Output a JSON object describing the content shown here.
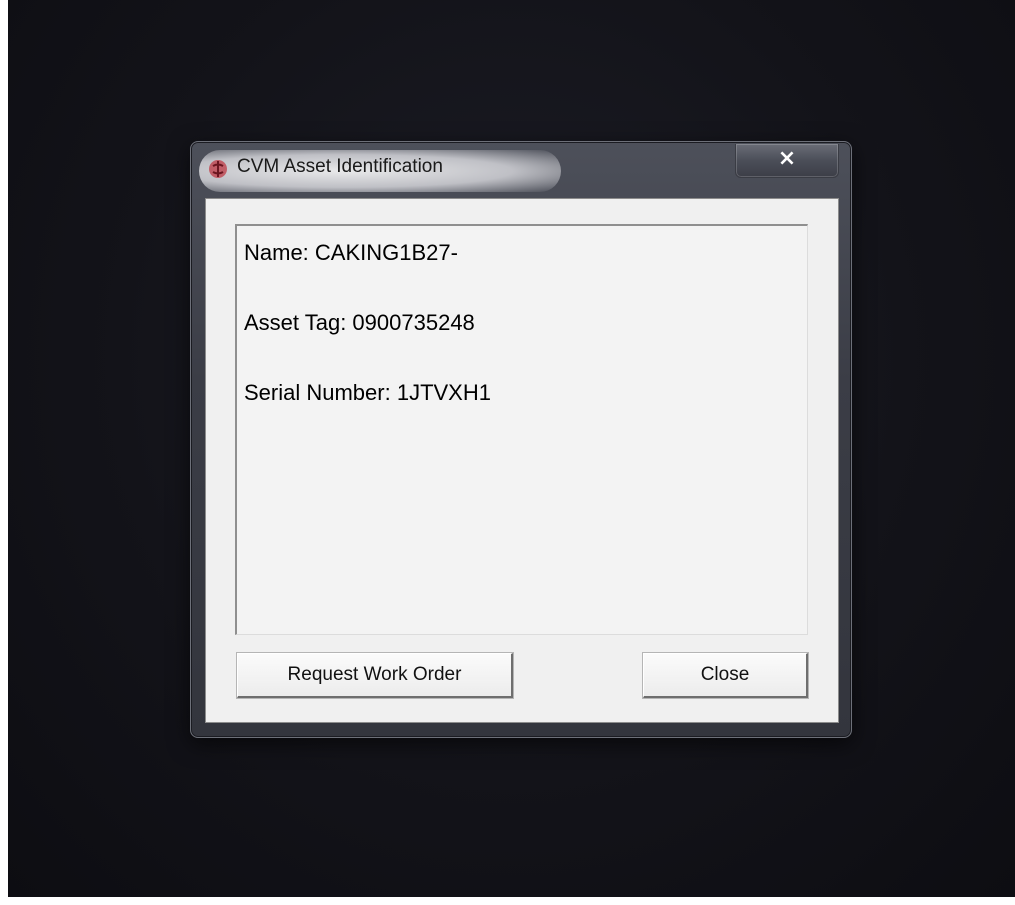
{
  "window": {
    "title": "CVM Asset Identification",
    "close_glyph": "×",
    "icon": "cvm-app-icon"
  },
  "info": {
    "name": "Name: CAKING1B27-",
    "asset_tag": "Asset Tag: 0900735248",
    "serial_number": "Serial Number: 1JTVXH1"
  },
  "buttons": {
    "request_label": "Request Work Order",
    "close_label": "Close"
  },
  "colors": {
    "desktop": "#131319",
    "client": "#f0f0f0",
    "icon_red": "#b23a46"
  }
}
